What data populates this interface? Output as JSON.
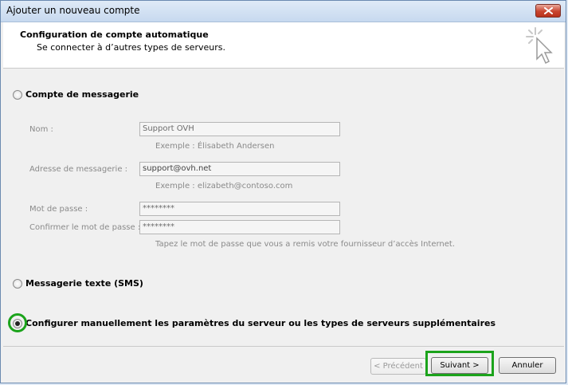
{
  "window": {
    "title": "Ajouter un nouveau compte"
  },
  "header": {
    "title": "Configuration de compte automatique",
    "subtitle": "Se connecter à d’autres types de serveurs."
  },
  "options": {
    "email_account": {
      "label": "Compte de messagerie",
      "selected": false
    },
    "sms": {
      "label": "Messagerie texte (SMS)",
      "selected": false
    },
    "manual": {
      "label": "Configurer manuellement les paramètres du serveur ou les types de serveurs supplémentaires",
      "selected": true
    }
  },
  "form": {
    "name": {
      "label": "Nom :",
      "value": "Support OVH",
      "example": "Exemple : Élisabeth Andersen"
    },
    "email": {
      "label": "Adresse de messagerie :",
      "value": "support@ovh.net",
      "example": "Exemple : elizabeth@contoso.com"
    },
    "password": {
      "label": "Mot de passe :",
      "value": "********"
    },
    "confirm": {
      "label": "Confirmer le mot de passe :",
      "value": "********",
      "hint": "Tapez le mot de passe que vous a remis votre fournisseur d’accès Internet."
    }
  },
  "buttons": {
    "previous": "< Précédent",
    "next": "Suivant >",
    "cancel": "Annuler"
  },
  "icons": {
    "close": "close-icon",
    "wizard": "wizard-cursor-icon"
  },
  "colors": {
    "highlight": "#1ba31b"
  }
}
